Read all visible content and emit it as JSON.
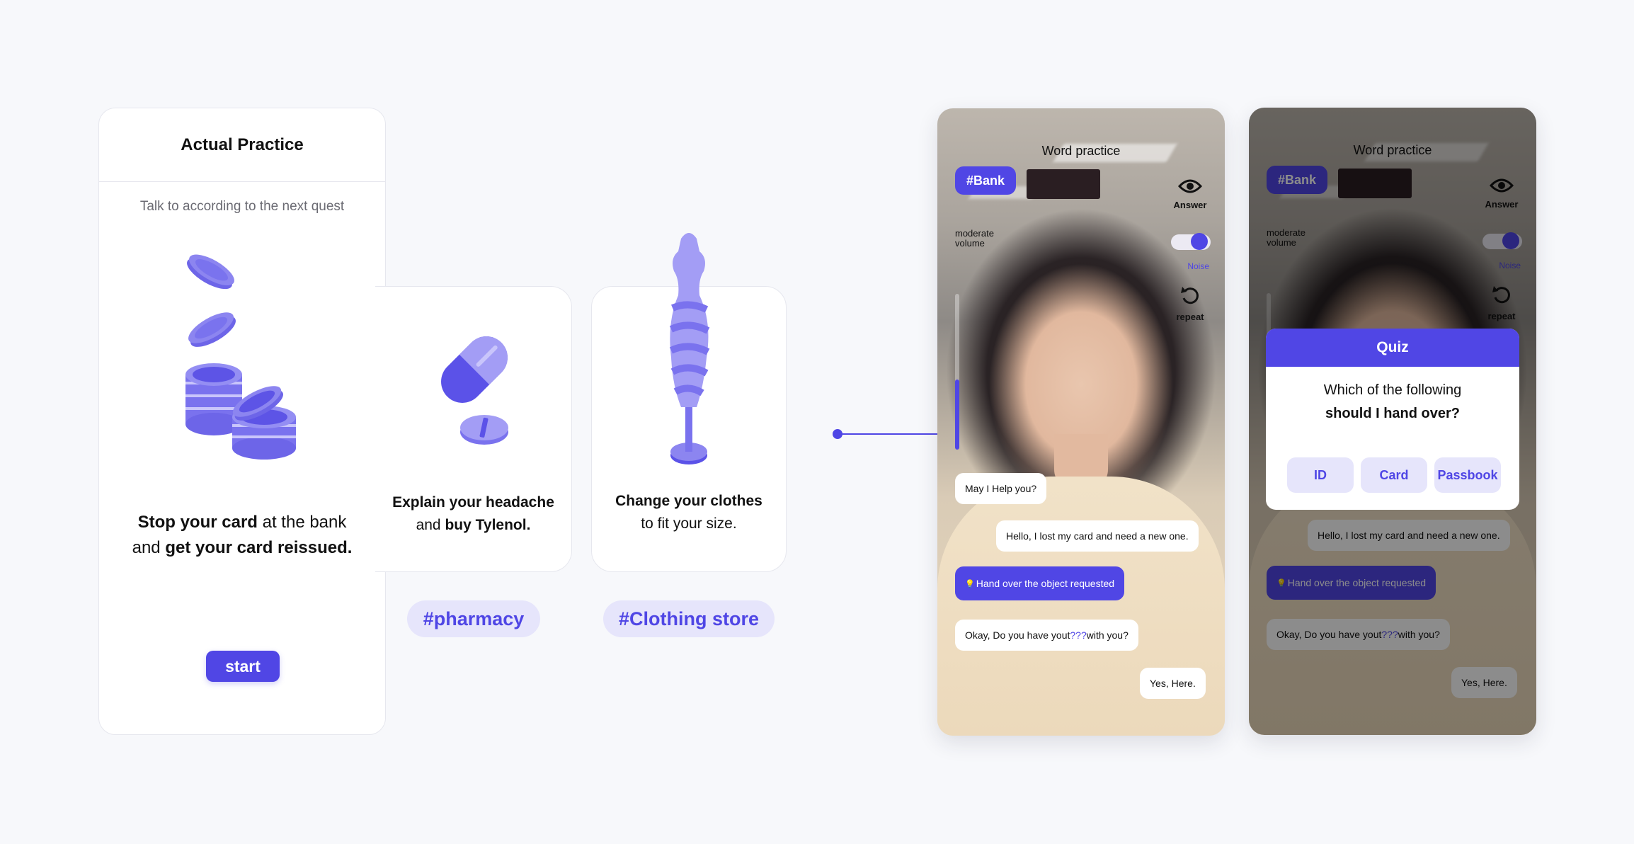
{
  "practice": {
    "title": "Actual Practice",
    "subtitle": "Talk to according to the next quest",
    "desc": {
      "line1_bold": "Stop your card",
      "line1_rest": " at the bank",
      "line2_pre": "and ",
      "line2_bold": "get your card reissued."
    },
    "start_label": "start"
  },
  "scenarios": [
    {
      "bold1": "Explain your headache",
      "line2_pre": "and ",
      "bold2": "buy Tylenol.",
      "tag": "#pharmacy"
    },
    {
      "bold1": "Change your clothes",
      "line2": "to fit your size.",
      "tag": "#Clothing store"
    }
  ],
  "phone": {
    "title": "Word practice",
    "tag": "#Bank",
    "answer_label": "Answer",
    "volume_label_1": "moderate",
    "volume_label_2": "volume",
    "noise_label": "Noise",
    "repeat_label": "repeat",
    "volume_level": 0.45,
    "chat": {
      "msg1": "May I Help you?",
      "msg2": "Hello, I lost my card and need a new one.",
      "hint": "Hand over the object requested",
      "msg4_pre": "Okay, Do you have yout ",
      "msg4_q": "???",
      "msg4_post": " with you?",
      "msg5": "Yes, Here."
    }
  },
  "quiz": {
    "title": "Quiz",
    "question_line1": "Which of the following",
    "question_line2": "should I hand over?",
    "options": [
      "ID",
      "Card",
      "Passbook"
    ]
  },
  "colors": {
    "accent": "#5046e5",
    "accent_light": "#e6e5fb"
  }
}
